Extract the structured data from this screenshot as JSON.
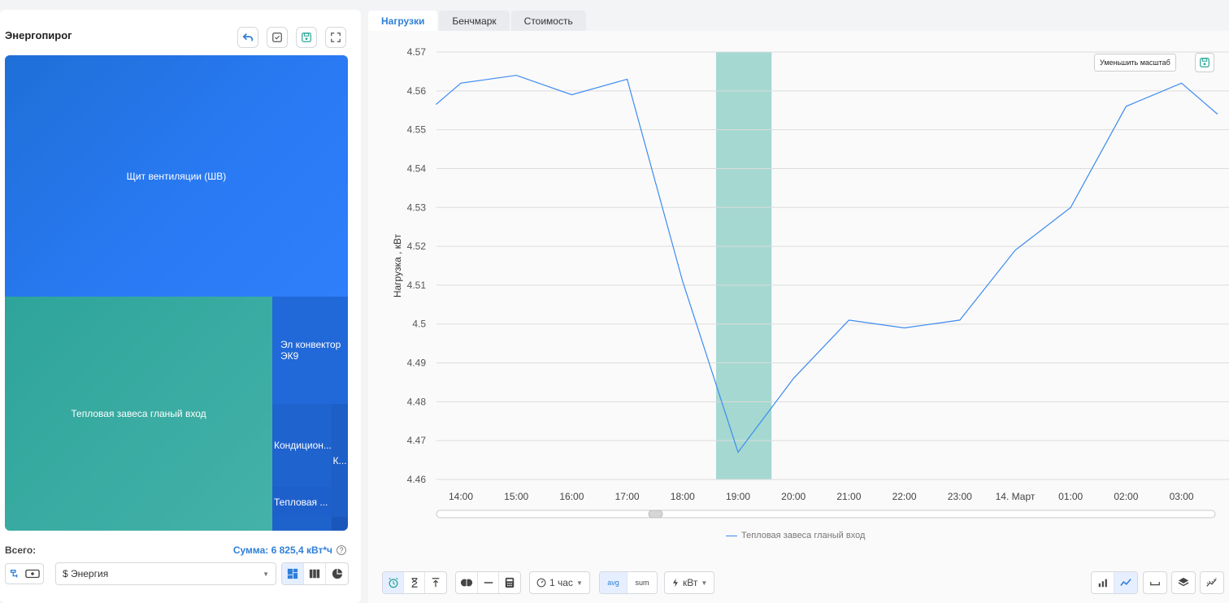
{
  "panel": {
    "title": "Энергопирог",
    "tiles": [
      "Щит вентиляции (ШВ)",
      "Тепловая завеса гланый вход",
      "Эл конвектор ЭК9",
      "Кондицион...",
      "К...",
      "Тепловая ..."
    ],
    "total_label": "Всего:",
    "total_sum": "Сумма: 6 825,4 кВт*ч",
    "help": "?",
    "metric_select": "$ Энергия"
  },
  "tabs": [
    "Нагрузки",
    "Бенчмарк",
    "Стоимость"
  ],
  "chart_controls": {
    "zoom_out": "Уменьшить масштаб",
    "interval": "1 час",
    "avg": "avg",
    "sum": "sum",
    "unit": "кВт"
  },
  "colors": {
    "accent": "#2f7fd8",
    "line": "#3c8bf0",
    "highlight": "#a5d8d1",
    "tile_blue": "#2272e8",
    "tile_teal": "#3aa9a3"
  },
  "chart_data": {
    "type": "line",
    "ylabel": "Нагрузка , кВт",
    "xlabel": "",
    "ylim": [
      4.46,
      4.57
    ],
    "yticks": [
      "4.57",
      "4.56",
      "4.55",
      "4.54",
      "4.53",
      "4.52",
      "4.51",
      "4.5",
      "4.49",
      "4.48",
      "4.47",
      "4.46"
    ],
    "xticks": [
      "14:00",
      "15:00",
      "16:00",
      "17:00",
      "18:00",
      "19:00",
      "20:00",
      "21:00",
      "22:00",
      "23:00",
      "14. Март",
      "01:00",
      "02:00",
      "03:00"
    ],
    "series": [
      {
        "name": "Тепловая завеса гланый вход",
        "x": [
          -0.45,
          -0.0,
          1.0,
          2.0,
          3.0,
          4.0,
          5.0,
          6.0,
          7.0,
          8.0,
          9.0,
          10.0,
          11.0,
          12.0,
          13.0,
          13.65
        ],
        "y": [
          4.5565,
          4.562,
          4.564,
          4.559,
          4.563,
          4.511,
          4.467,
          4.486,
          4.501,
          4.499,
          4.501,
          4.519,
          4.53,
          4.556,
          4.562,
          4.554
        ]
      }
    ],
    "highlight_range": [
      5.0,
      6.0
    ],
    "grid": true,
    "legend": "bottom"
  }
}
